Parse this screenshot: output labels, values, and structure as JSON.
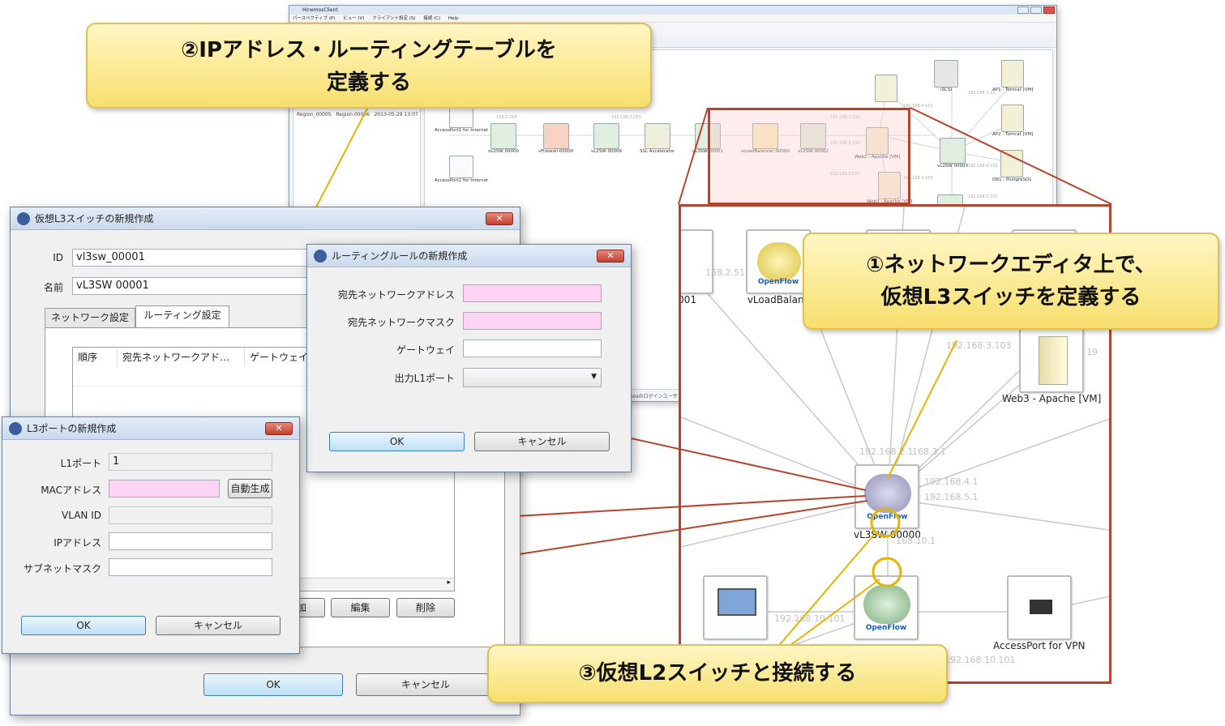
{
  "app": {
    "title": "HinemosClient",
    "menu": [
      "パースペクティブ (P)",
      "ビュー (V)",
      "クライアント設定 (S)",
      "接続 (C)",
      "Help"
    ],
    "left_row": [
      "Region_00005",
      "Region 00006",
      "2013-05-29 13:07"
    ],
    "status": "nosのログインユーザ :",
    "nodes": {
      "ap1": "AccessPort1 for Internet",
      "ap2": "AccessPort2 for Internet",
      "sw1": "vL2SW 00000",
      "fw": "vFirewall 00000",
      "sw6": "vL2SW 00006",
      "ssl": "SSL Accelerator",
      "l3": "vL3SW 00001",
      "lb": "vLoadBalancer 00000",
      "sw2": "vL2SW 00002",
      "web2": "Web2 - Apache [VM]",
      "web3": "Web3 - Apache [VM]",
      "iscsi": "iSCSI",
      "apt1": "AP1 - Tomcat [VM]",
      "apt2": "AP2 - Tomcat [VM]",
      "sw3": "vL2SW 00003",
      "db1": "DB1 - PostgreSQL"
    },
    "ips": [
      "168.2.254",
      "192.168.2.253",
      "192.168.2.102",
      "192.168.3.102",
      "192.168.3.103",
      "192.168.4.101",
      "192.168.4.103",
      "192.168.4.151",
      "192.168.5.11",
      "192.168.5.102"
    ]
  },
  "zoom": {
    "openflow": "OpenFlow",
    "nodes": {
      "left_partial": "00001",
      "lb": "vLoadBalanc",
      "web3": "Web3 - Apache [VM]",
      "l3": "vL3SW 00000",
      "vpn": "AccessPort for VPN"
    },
    "ips": {
      "ip1": "168.2.51",
      "ip2": "192.168.3.103",
      "ip3": "192.168.2.1",
      "ip4": "168.3.1",
      "ip5": "192.168.4.1",
      "ip6": "192.168.5.1",
      "ip7": "168.10.1",
      "ip8": "192.168.10.101",
      "ip9": "192.168.10.101",
      "ip10": "19"
    }
  },
  "l3_dialog": {
    "title": "仮想L3スイッチの新規作成",
    "close": "✕",
    "id_label": "ID",
    "id_value": "vl3sw_00001",
    "name_label": "名前",
    "name_value": "vL3SW 00001",
    "tabs": [
      "ネットワーク設定",
      "ルーティング設定"
    ],
    "columns": [
      "順序",
      "宛先ネットワークアド…",
      "ゲートウェイ"
    ],
    "buttons": {
      "add": "加",
      "edit": "編集",
      "delete": "削除",
      "ok": "OK",
      "cancel": "キャンセル"
    }
  },
  "routing_dialog": {
    "title": "ルーティングルールの新規作成",
    "close": "✕",
    "dest_addr_label": "宛先ネットワークアドレス",
    "dest_mask_label": "宛先ネットワークマスク",
    "gateway_label": "ゲートウェイ",
    "port_label": "出力L1ポート",
    "ok": "OK",
    "cancel": "キャンセル"
  },
  "port_dialog": {
    "title": "L3ポートの新規作成",
    "close": "✕",
    "l1_label": "L1ポート",
    "l1_value": "1",
    "mac_label": "MACアドレス",
    "auto_btn": "自動生成",
    "vlan_label": "VLAN ID",
    "ip_label": "IPアドレス",
    "mask_label": "サブネットマスク",
    "ok": "OK",
    "cancel": "キャンセル"
  },
  "callouts": {
    "c1_line1": "①ネットワークエディタ上で、",
    "c1_line2": "仮想L3スイッチを定義する",
    "c2_line1": "②IPアドレス・ルーティングテーブルを",
    "c2_line2": "定義する",
    "c3": "③仮想L2スイッチと接続する"
  },
  "colors": {
    "accent_line": "#b5442e",
    "callout_line": "#e2b500",
    "pink_field": "#ffd3f4"
  }
}
